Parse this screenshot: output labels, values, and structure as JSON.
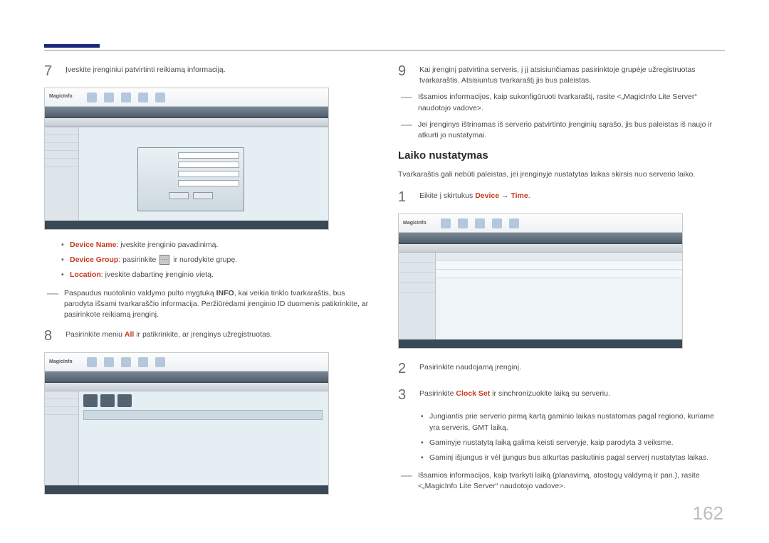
{
  "pageNumber": "162",
  "left": {
    "step7": {
      "num": "7",
      "text": "Įveskite įrenginiui patvirtinti reikiamą informaciją.",
      "shotLogo": "MagicInfo"
    },
    "bullets": [
      {
        "label": "Device Name",
        "rest": ": įveskite įrenginio pavadinimą."
      },
      {
        "label": "Device Group",
        "rest_pre": ": pasirinkite ",
        "rest_post": " ir nurodykite grupę."
      },
      {
        "label": "Location",
        "rest": ": įveskite dabartinę įrenginio vietą."
      }
    ],
    "note7": "Paspaudus nuotolinio valdymo pulto mygtuką INFO, kai veikia tinklo tvarkaraštis, bus parodyta išsami tvarkaraščio informacija. Peržiūrėdami įrenginio ID duomenis patikrinkite, ar pasirinkote reikiamą įrenginį.",
    "note7_bold": "INFO",
    "step8": {
      "num": "8",
      "pre": "Pasirinkite meniu ",
      "link": "All",
      "post": " ir patikrinkite, ar įrenginys užregistruotas."
    }
  },
  "right": {
    "step9": {
      "num": "9",
      "text": "Kai įrenginį patvirtina serveris, į jį atsisiunčiamas pasirinktoje grupėje užregistruotas tvarkaraštis. Atsisiuntus tvarkaraštį jis bus paleistas."
    },
    "dash1": "Išsamios informacijos, kaip sukonfigūruoti tvarkaraštį, rasite <„MagicInfo Lite Server“ naudotojo vadove>.",
    "dash2": "Jei įrenginys ištrinamas iš serverio patvirtinto įrenginių sąrašo, jis bus paleistas iš naujo ir atkurti jo nustatymai.",
    "heading": "Laiko nustatymas",
    "intro": "Tvarkaraštis gali nebūti paleistas, jei įrenginyje nustatytas laikas skirsis nuo serverio laiko.",
    "step1": {
      "num": "1",
      "pre": "Eikite į skirtukus ",
      "a": "Device",
      "arrow": " → ",
      "b": "Time",
      "post": "."
    },
    "step2": {
      "num": "2",
      "text": "Pasirinkite naudojamą įrenginį."
    },
    "step3": {
      "num": "3",
      "pre": "Pasirinkite ",
      "link": "Clock Set",
      "post": " ir sinchronizuokite laiką su serveriu."
    },
    "bullets2": [
      "Jungiantis prie serverio pirmą kartą gaminio laikas nustatomas pagal regiono, kuriame yra serveris, GMT laiką.",
      "Gaminyje nustatytą laiką galima keisti serveryje, kaip parodyta 3 veiksme.",
      "Gaminį išjungus ir vėl įjungus bus atkurtas paskutinis pagal serverį nustatytas laikas."
    ],
    "dash3": "Išsamios informacijos, kaip tvarkyti laiką (planavimą, atostogų valdymą ir pan.), rasite <„MagicInfo Lite Server“ naudotojo vadove>."
  }
}
